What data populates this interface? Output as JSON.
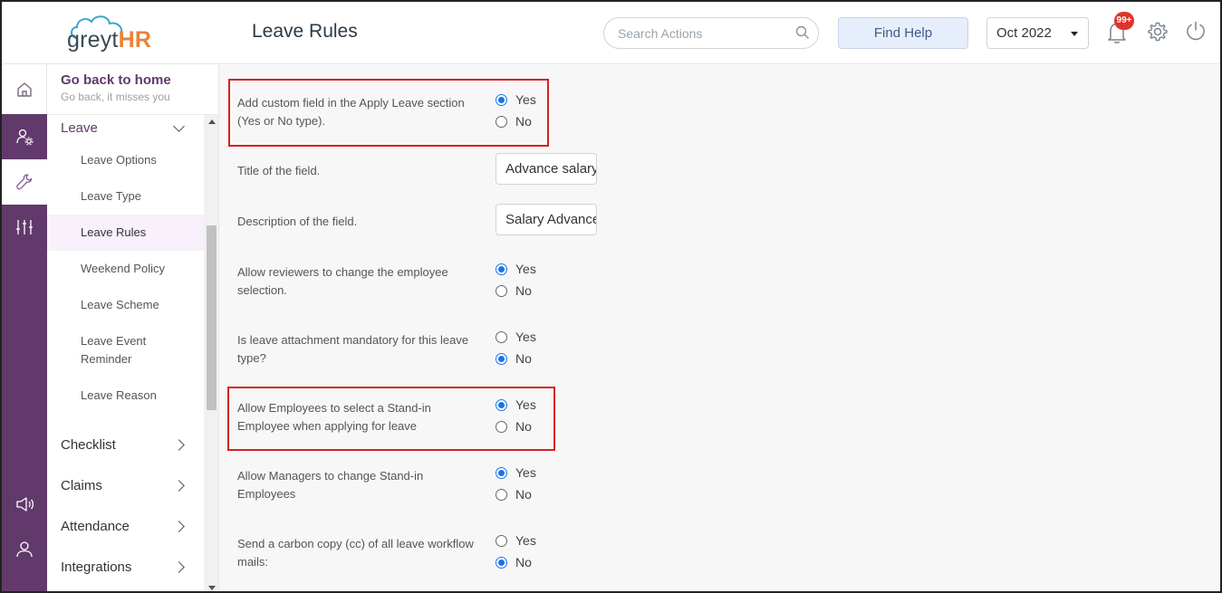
{
  "header": {
    "logo_greyt": "greyt",
    "logo_hr": "HR",
    "page_title": "Leave Rules",
    "search_placeholder": "Search Actions",
    "find_help_label": "Find Help",
    "month_value": "Oct 2022",
    "notification_count": "99+"
  },
  "sidebar": {
    "home_title": "Go back to home",
    "home_subtitle": "Go back, it misses you",
    "leave_section": "Leave",
    "leave_items": [
      "Leave Options",
      "Leave Type",
      "Leave Rules",
      "Weekend Policy",
      "Leave Scheme",
      "Leave Event",
      "Reminder",
      "Leave Reason"
    ],
    "active_item": "Leave Rules",
    "sections": [
      "Checklist",
      "Claims",
      "Attendance",
      "Integrations"
    ]
  },
  "rules": {
    "q1_line1": "Add custom field in the Apply Leave section",
    "q1_line2": "(Yes or No type).",
    "q1_value": "Yes",
    "title_label": "Title of the field.",
    "title_value": "Advance salary",
    "desc_label": "Description of the field.",
    "desc_value": "Salary Advance",
    "q2_line1": "Allow reviewers to change the employee",
    "q2_line2": "selection.",
    "q2_value": "Yes",
    "q3_line1": "Is leave attachment mandatory for this leave",
    "q3_line2": "type?",
    "q3_value": "No",
    "q4_line1": "Allow Employees to select a Stand-in",
    "q4_line2": "Employee when applying for leave",
    "q4_value": "Yes",
    "q5_line1": "Allow Managers to change Stand-in",
    "q5_line2": "Employees",
    "q5_value": "Yes",
    "q6_line1": "Send a carbon copy (cc) of all leave workflow",
    "q6_line2": "mails:",
    "q6_value": "No",
    "yes_label": "Yes",
    "no_label": "No"
  },
  "colors": {
    "brand_purple": "#613a6b",
    "radio_blue": "#1a73e8",
    "highlight_red": "#d62020",
    "logo_orange": "#e8833a"
  },
  "icons": {
    "rail": [
      "home-icon",
      "user-settings-icon",
      "wrench-icon",
      "sliders-icon",
      "megaphone-icon",
      "user-icon"
    ],
    "header": [
      "search-icon",
      "bell-icon",
      "gear-icon",
      "power-icon"
    ]
  }
}
